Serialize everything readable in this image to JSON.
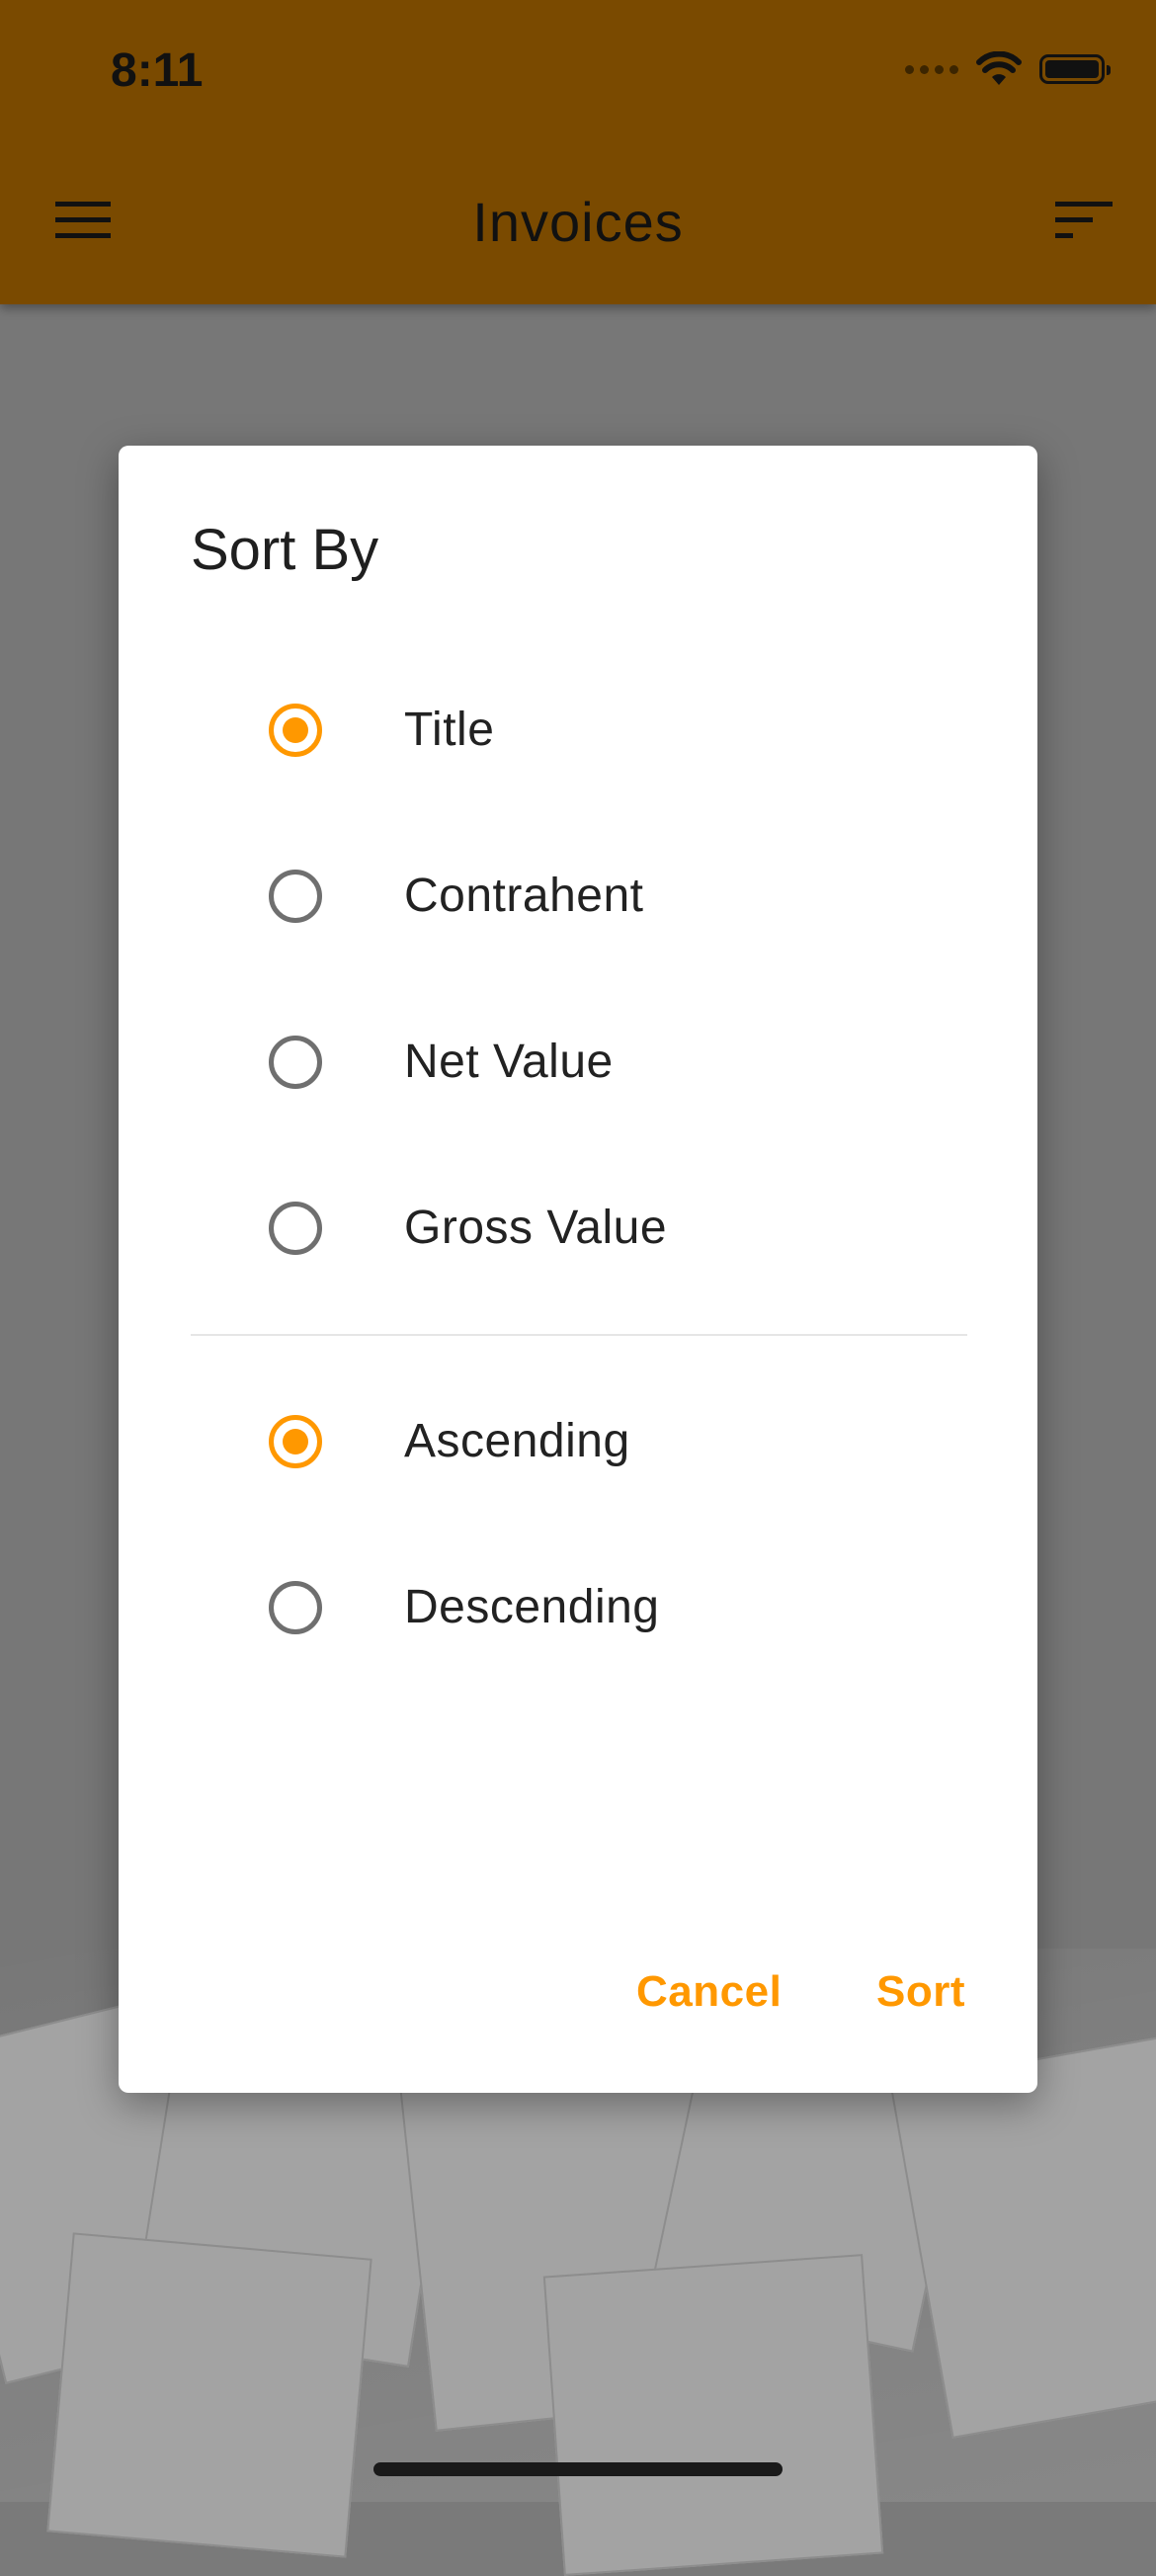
{
  "status_bar": {
    "time": "8:11"
  },
  "app_bar": {
    "title": "Invoices",
    "menu_icon": "hamburger-menu-icon",
    "sort_icon": "sort-icon"
  },
  "dialog": {
    "title": "Sort By",
    "sort_fields": [
      {
        "label": "Title",
        "checked": true
      },
      {
        "label": "Contrahent",
        "checked": false
      },
      {
        "label": "Net Value",
        "checked": false
      },
      {
        "label": "Gross Value",
        "checked": false
      }
    ],
    "order": [
      {
        "label": "Ascending",
        "checked": true
      },
      {
        "label": "Descending",
        "checked": false
      }
    ],
    "cancel_label": "Cancel",
    "sort_label": "Sort"
  },
  "colors": {
    "accent": "#ff9800",
    "app_bar_dimmed": "#7a4a00",
    "radio_unchecked": "#6f6f6f"
  }
}
